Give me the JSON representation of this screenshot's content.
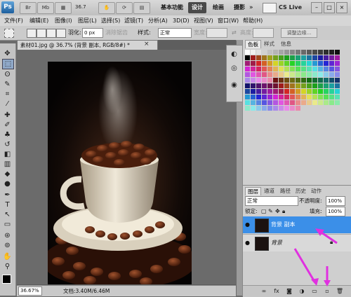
{
  "app": {
    "logo": "Ps",
    "zoom": "36.7",
    "workspaces": [
      "基本功能",
      "设计",
      "绘画",
      "摄影"
    ],
    "workspace_more": "»",
    "cs_live": "CS Live",
    "window_controls": [
      "–",
      "□",
      "×"
    ]
  },
  "menu": [
    "文件(F)",
    "编辑(E)",
    "图像(I)",
    "图层(L)",
    "选择(S)",
    "滤镜(T)",
    "分析(A)",
    "3D(D)",
    "视图(V)",
    "窗口(W)",
    "帮助(H)"
  ],
  "options": {
    "feather_label": "羽化:",
    "feather_value": "0 px",
    "antialias_label": "消除锯齿",
    "style_label": "样式:",
    "style_value": "正常",
    "width_label": "宽度:",
    "height_label": "高度:",
    "refine_edge": "调整边缘..."
  },
  "document": {
    "tab_title": "素材01.jpg @ 36.7% (背景 副本, RGB/8#) *",
    "tab_close": "×",
    "status_zoom": "36.67%",
    "status_doc": "文档:3.40M/6.46M"
  },
  "swatches_panel": {
    "tabs": [
      "色板",
      "样式",
      "信息"
    ]
  },
  "layers_panel": {
    "tabs": [
      "图层",
      "通道",
      "路径",
      "历史",
      "动作"
    ],
    "blend_mode": "正常",
    "opacity_label": "不透明度:",
    "opacity_value": "100%",
    "lock_label": "锁定:",
    "fill_label": "填充:",
    "fill_value": "100%",
    "layers": [
      {
        "name": "背景 副本",
        "selected": true
      },
      {
        "name": "背景",
        "selected": false
      }
    ]
  },
  "colors": {
    "selection_blue": "#3b8fe8",
    "arrow_magenta": "#e030e0"
  }
}
